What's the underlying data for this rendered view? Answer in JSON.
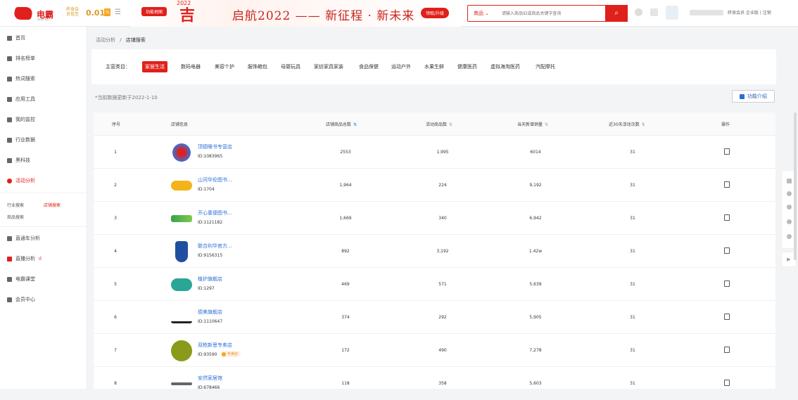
{
  "header": {
    "logo_text": "电霸",
    "logo_sub": "Dian Ba",
    "vip_line1": "终身会",
    "vip_line2": "员低至",
    "vip_price": "0.01",
    "vip_unit": "元",
    "banner_badge": "功能地图",
    "banner_char": "吉",
    "banner_year": "2022",
    "banner_slogan": "启航2022 —— 新征程 · 新未来",
    "banner_button": "领取/升级",
    "search_category": "商品",
    "search_placeholder": "请输入商品ID或商品关键字查询",
    "user_link": "终身会员 企业版 | 注销",
    "accent": "#e0201b"
  },
  "sidebar": {
    "items": [
      {
        "label": "首页",
        "icon": "home-icon"
      },
      {
        "label": "排名榜单",
        "icon": "bar-chart-icon"
      },
      {
        "label": "热词搜索",
        "icon": "fire-icon"
      },
      {
        "label": "应用工具",
        "icon": "tool-icon"
      },
      {
        "label": "我的监控",
        "icon": "monitor-icon"
      },
      {
        "label": "行业数据",
        "icon": "pie-icon"
      },
      {
        "label": "黑科技",
        "icon": "rocket-icon"
      },
      {
        "label": "活动分析",
        "icon": "activity-icon"
      },
      {
        "label": "直通车分析",
        "icon": "car-icon"
      },
      {
        "label": "直播分析",
        "icon": "live-icon"
      },
      {
        "label": "电霸课堂",
        "icon": "class-icon"
      },
      {
        "label": "会员中心",
        "icon": "member-icon"
      }
    ],
    "subs": [
      "行业搜索",
      "店铺搜索",
      "商品搜索"
    ]
  },
  "breadcrumb": {
    "parent": "活动分析",
    "sep": "/",
    "current": "店铺搜索"
  },
  "filter": {
    "label": "主营类目：",
    "categories": [
      "家居生活",
      "数码电器",
      "美容个护",
      "服饰箱包",
      "母婴玩具",
      "家纺家具家装",
      "食品保健",
      "运动户外",
      "水果生鲜",
      "健康医药",
      "虚拟海淘医药",
      "汽配摩托"
    ],
    "active_index": 0
  },
  "note": "*当前数据更新于2022-1-10",
  "func_button": "功能介绍",
  "table": {
    "columns": [
      "序号",
      "店铺信息",
      "店铺商品总数",
      "活动商品数",
      "当天新增销量",
      "近30天活动次数",
      "操作"
    ],
    "rows": [
      {
        "no": "1",
        "name": "顶德眼书专营店",
        "id": "ID:1083965",
        "total": "2553",
        "act": "1,995",
        "sales": "6014",
        "times": "31",
        "logo_color": "#3b6fd8"
      },
      {
        "no": "2",
        "name": "山河华伦图书...",
        "id": "ID:1704",
        "total": "1,964",
        "act": "224",
        "sales": "9,192",
        "times": "31",
        "logo_color": "#f2b418"
      },
      {
        "no": "3",
        "name": "开心童便图书...",
        "id": "ID:1121182",
        "total": "1,669",
        "act": "340",
        "sales": "6,942",
        "times": "31",
        "logo_color": "#3aa14a"
      },
      {
        "no": "4",
        "name": "联合利华官方...",
        "id": "ID:9156315",
        "total": "892",
        "act": "3,192",
        "sales": "1.42w",
        "times": "31",
        "logo_color": "#1f4fa0"
      },
      {
        "no": "5",
        "name": "植护旗舰店",
        "id": "ID:1297",
        "total": "469",
        "act": "571",
        "sales": "5,639",
        "times": "31",
        "logo_color": "#2aa596"
      },
      {
        "no": "6",
        "name": "德美旗舰店",
        "id": "ID:1110647",
        "total": "374",
        "act": "292",
        "sales": "5,905",
        "times": "31",
        "logo_color": "#222222"
      },
      {
        "no": "7",
        "name": "双枪新思专卖店",
        "id": "ID:93590",
        "total": "172",
        "act": "490",
        "sales": "7,278",
        "times": "31",
        "logo_color": "#8a9a1a",
        "tag": "专卖店"
      },
      {
        "no": "8",
        "name": "安然家居馆",
        "id": "ID:678466",
        "total": "118",
        "act": "358",
        "sales": "5,603",
        "times": "31",
        "logo_color": "#666666"
      }
    ]
  }
}
